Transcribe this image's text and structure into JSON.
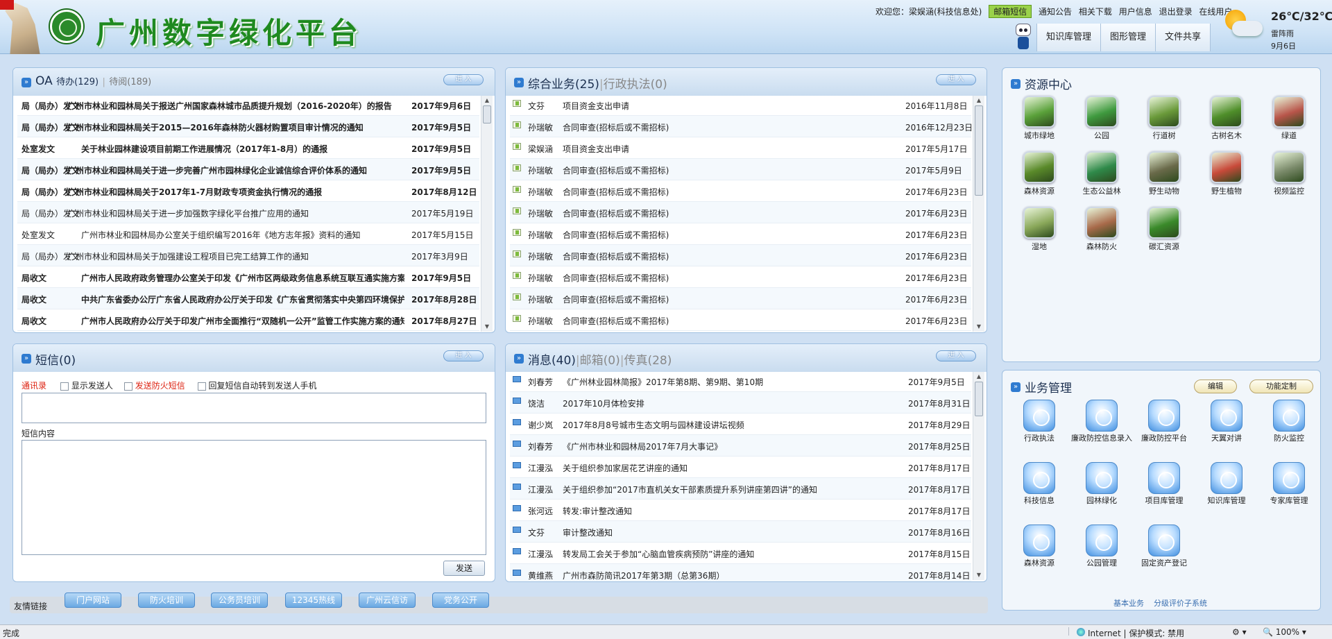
{
  "header": {
    "title": "广州数字绿化平台",
    "welcome": "欢迎您：梁娱涵(科技信息处)",
    "mail_btn": "邮箱短信",
    "links": [
      "通知公告",
      "相关下载",
      "用户信息",
      "退出登录",
      "在线用户"
    ],
    "nav": [
      "知识库管理",
      "图形管理",
      "文件共享"
    ],
    "weather": {
      "temp": "26℃/32℃",
      "desc": "雷阵雨",
      "date": "9月6日"
    }
  },
  "oa": {
    "title": "OA",
    "pending": "待办(129)",
    "sep": "|",
    "read": "待阅(189)",
    "enter": "进 入",
    "rows": [
      {
        "dept": "局（局办）发文",
        "title": "广州市林业和园林局关于报送广州国家森林城市品质提升规划（2016-2020年）的报告",
        "date": "2017年9月6日",
        "bold": true
      },
      {
        "dept": "局（局办）发文",
        "title": "广州市林业和园林局关于2015—2016年森林防火器材购置项目审计情况的通知",
        "date": "2017年9月5日",
        "bold": true
      },
      {
        "dept": "处室发文",
        "title": "关于林业园林建设项目前期工作进展情况（2017年1-8月）的通报",
        "date": "2017年9月5日",
        "bold": true
      },
      {
        "dept": "局（局办）发文",
        "title": "广州市林业和园林局关于进一步完善广州市园林绿化企业诚信综合评价体系的通知",
        "date": "2017年9月5日",
        "bold": true
      },
      {
        "dept": "局（局办）发文",
        "title": "广州市林业和园林局关于2017年1-7月财政专项资金执行情况的通报",
        "date": "2017年8月12日",
        "bold": true
      },
      {
        "dept": "局（局办）发文",
        "title": "广州市林业和园林局关于进一步加强数字绿化平台推广应用的通知",
        "date": "2017年5月19日",
        "bold": false
      },
      {
        "dept": "处室发文",
        "title": "广州市林业和园林局办公室关于组织编写2016年《地方志年报》资料的通知",
        "date": "2017年5月15日",
        "bold": false
      },
      {
        "dept": "局（局办）发文",
        "title": "广州市林业和园林局关于加强建设工程项目已完工结算工作的通知",
        "date": "2017年3月9日",
        "bold": false
      },
      {
        "dept": "局收文",
        "title": "广州市人民政府政务管理办公室关于印发《广州市区两级政务信息系统互联互通实施方案》",
        "date": "2017年9月5日",
        "bold": true
      },
      {
        "dept": "局收文",
        "title": "中共广东省委办公厅广东省人民政府办公厅关于印发《广东省贯彻落实中央第四环境保护督",
        "date": "2017年8月28日",
        "bold": true
      },
      {
        "dept": "局收文",
        "title": "广州市人民政府办公厅关于印发广州市全面推行“双随机一公开”监管工作实施方案的通知",
        "date": "2017年8月27日",
        "bold": true
      }
    ]
  },
  "biz": {
    "title": "综合业务(25)",
    "sep": "|",
    "title2": "行政执法(0)",
    "enter": "进 入",
    "rows": [
      {
        "person": "文芬",
        "item": "项目资金支出申请",
        "date": "2016年11月8日"
      },
      {
        "person": "孙瑞敏",
        "item": "合同审查(招标后或不需招标)",
        "date": "2016年12月23日"
      },
      {
        "person": "梁娱涵",
        "item": "项目资金支出申请",
        "date": "2017年5月17日"
      },
      {
        "person": "孙瑞敏",
        "item": "合同审查(招标后或不需招标)",
        "date": "2017年5月9日"
      },
      {
        "person": "孙瑞敏",
        "item": "合同审查(招标后或不需招标)",
        "date": "2017年6月23日"
      },
      {
        "person": "孙瑞敏",
        "item": "合同审查(招标后或不需招标)",
        "date": "2017年6月23日"
      },
      {
        "person": "孙瑞敏",
        "item": "合同审查(招标后或不需招标)",
        "date": "2017年6月23日"
      },
      {
        "person": "孙瑞敏",
        "item": "合同审查(招标后或不需招标)",
        "date": "2017年6月23日"
      },
      {
        "person": "孙瑞敏",
        "item": "合同审查(招标后或不需招标)",
        "date": "2017年6月23日"
      },
      {
        "person": "孙瑞敏",
        "item": "合同审查(招标后或不需招标)",
        "date": "2017年6月23日"
      },
      {
        "person": "孙瑞敏",
        "item": "合同审查(招标后或不需招标)",
        "date": "2017年6月23日"
      }
    ]
  },
  "sms": {
    "title": "短信(0)",
    "enter": "进 入",
    "contacts": "通讯录",
    "show_sender": "显示发送人",
    "fire_sms": "发送防火短信",
    "auto_reply": "回复短信自动转到发送人手机",
    "content_label": "短信内容",
    "send": "发送"
  },
  "msg": {
    "title": "消息(40)",
    "sep": "|",
    "mail": "邮箱(0)",
    "fax": "传真(28)",
    "enter": "进 入",
    "rows": [
      {
        "person": "刘春芳",
        "subject": "《广州林业园林简报》2017年第8期、第9期、第10期",
        "date": "2017年9月5日"
      },
      {
        "person": "饶洁",
        "subject": "2017年10月体检安排",
        "date": "2017年8月31日"
      },
      {
        "person": "谢少岚",
        "subject": "2017年8月8号城市生态文明与园林建设讲坛视频",
        "date": "2017年8月29日"
      },
      {
        "person": "刘春芳",
        "subject": "《广州市林业和园林局2017年7月大事记》",
        "date": "2017年8月25日"
      },
      {
        "person": "江漫泓",
        "subject": "关于组织参加家居花艺讲座的通知",
        "date": "2017年8月17日"
      },
      {
        "person": "江漫泓",
        "subject": "关于组织参加“2017市直机关女干部素质提升系列讲座第四讲”的通知",
        "date": "2017年8月17日"
      },
      {
        "person": "张河远",
        "subject": "转发:审计整改通知",
        "date": "2017年8月17日"
      },
      {
        "person": "文芬",
        "subject": "审计整改通知",
        "date": "2017年8月16日"
      },
      {
        "person": "江漫泓",
        "subject": "转发局工会关于参加“心脑血管疾病预防”讲座的通知",
        "date": "2017年8月15日"
      },
      {
        "person": "黄维燕",
        "subject": "广州市森防简讯2017年第3期（总第36期）",
        "date": "2017年8月14日"
      }
    ]
  },
  "resource": {
    "title": "资源中心",
    "items": [
      {
        "label": "城市绿地",
        "color": "#5aa13a"
      },
      {
        "label": "公园",
        "color": "#3f9a3f"
      },
      {
        "label": "行道树",
        "color": "#6a9a3a"
      },
      {
        "label": "古树名木",
        "color": "#4f8f2a"
      },
      {
        "label": "绿道",
        "color": "#b8554a"
      },
      {
        "label": "森林资源",
        "color": "#5a8a2a"
      },
      {
        "label": "生态公益林",
        "color": "#2f8a4a"
      },
      {
        "label": "野生动物",
        "color": "#6a6a4a"
      },
      {
        "label": "野生植物",
        "color": "#c84a3a"
      },
      {
        "label": "视频监控",
        "color": "#7a8a6a"
      },
      {
        "label": "湿地",
        "color": "#8aa85a"
      },
      {
        "label": "森林防火",
        "color": "#a86a4a"
      },
      {
        "label": "碳汇资源",
        "color": "#3a8a2a"
      }
    ]
  },
  "business": {
    "title": "业务管理",
    "edit": "编辑",
    "custom": "功能定制",
    "items": [
      "行政执法",
      "廉政防控信息录入",
      "廉政防控平台",
      "天翼对讲",
      "防火监控",
      "科技信息",
      "园林绿化",
      "项目库管理",
      "知识库管理",
      "专家库管理",
      "森林资源",
      "公园管理",
      "固定资产登记"
    ],
    "footer_links": [
      "基本业务",
      "分级评价子系统"
    ]
  },
  "friend": {
    "label": "友情链接",
    "links": [
      "门户网站",
      "防火培训",
      "公务员培训",
      "12345热线",
      "广州云信访",
      "党务公开"
    ]
  },
  "status": {
    "done": "完成",
    "zone": "Internet | 保护模式: 禁用",
    "zoom": "100%"
  }
}
